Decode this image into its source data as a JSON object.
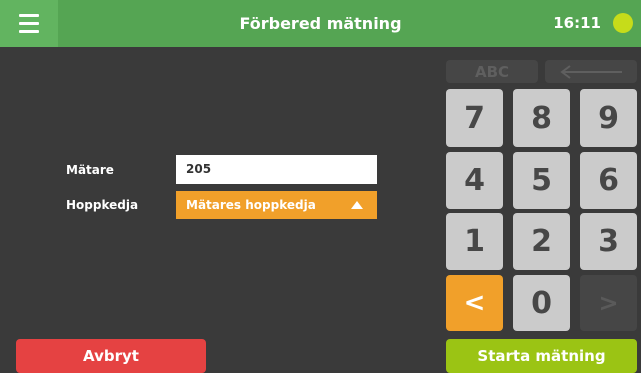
{
  "header": {
    "title": "Förbered mätning",
    "time": "16:11",
    "menu_icon": "hamburger-menu-icon",
    "status_icon": "status-dot-icon",
    "bar_color": "#55a553",
    "status_color": "#c6dc1a"
  },
  "form": {
    "meter_label": "Mätare",
    "meter_value": "205",
    "chain_label": "Hoppkedja",
    "chain_value": "Mätares hoppkedja",
    "chain_icon": "caret-up-icon",
    "accent_color": "#f1a02a"
  },
  "keypad": {
    "abc_label": "ABC",
    "backspace_icon": "backspace-arrow-icon",
    "keys": [
      "7",
      "8",
      "9",
      "4",
      "5",
      "6",
      "1",
      "2",
      "3"
    ],
    "zero": "0",
    "left_glyph": "<",
    "right_glyph": ">",
    "left_icon": "chevron-left-icon",
    "right_icon": "chevron-right-icon"
  },
  "footer": {
    "cancel_label": "Avbryt",
    "start_label": "Starta mätning",
    "cancel_color": "#e54242",
    "start_color": "#9bc414"
  }
}
